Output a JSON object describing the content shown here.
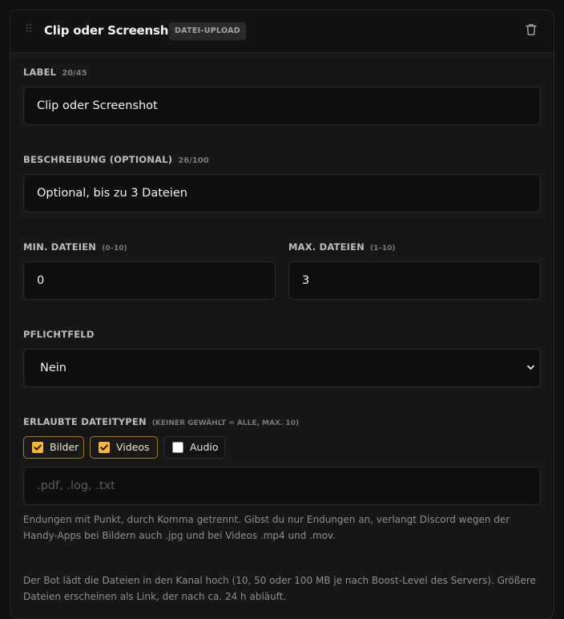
{
  "card": {
    "title": "Clip oder Screenshot",
    "type_badge": "DATEI-UPLOAD",
    "drag_icon": "drag-handle-icon",
    "delete_icon": "trash-icon"
  },
  "label_field": {
    "label": "LABEL",
    "counter": "20/45",
    "value": "Clip oder Screenshot"
  },
  "description_field": {
    "label": "BESCHREIBUNG (OPTIONAL)",
    "counter": "26/100",
    "value": "Optional, bis zu 3 Dateien"
  },
  "min_files": {
    "label": "MIN. DATEIEN",
    "range": "(0–10)",
    "value": "0"
  },
  "max_files": {
    "label": "MAX. DATEIEN",
    "range": "(1–10)",
    "value": "3"
  },
  "required_field": {
    "label": "PFLICHTFELD",
    "selected": "Nein"
  },
  "file_types": {
    "label": "ERLAUBTE DATEITYPEN",
    "hint": "(KEINER GEWÄHLT = ALLE, MAX. 10)",
    "options": [
      {
        "label": "Bilder",
        "checked": true
      },
      {
        "label": "Videos",
        "checked": true
      },
      {
        "label": "Audio",
        "checked": false
      }
    ],
    "extensions_placeholder": ".pdf, .log, .txt",
    "extensions_value": ""
  },
  "help_texts": {
    "extensions_hint": "Endungen mit Punkt, durch Komma getrennt. Gibst du nur Endungen an, verlangt Discord wegen der Handy-Apps bei Bildern auch .jpg und bei Videos .mp4 und .mov.",
    "upload_info": "Der Bot lädt die Dateien in den Kanal hoch (10, 50 oder 100 MB je nach Boost-Level des Servers). Größere Dateien erscheinen als Link, der nach ca. 24 h abläuft."
  },
  "colors": {
    "accent": "#f5b63b",
    "background": "#111111",
    "card": "#171717",
    "input": "#0f0f0f"
  }
}
